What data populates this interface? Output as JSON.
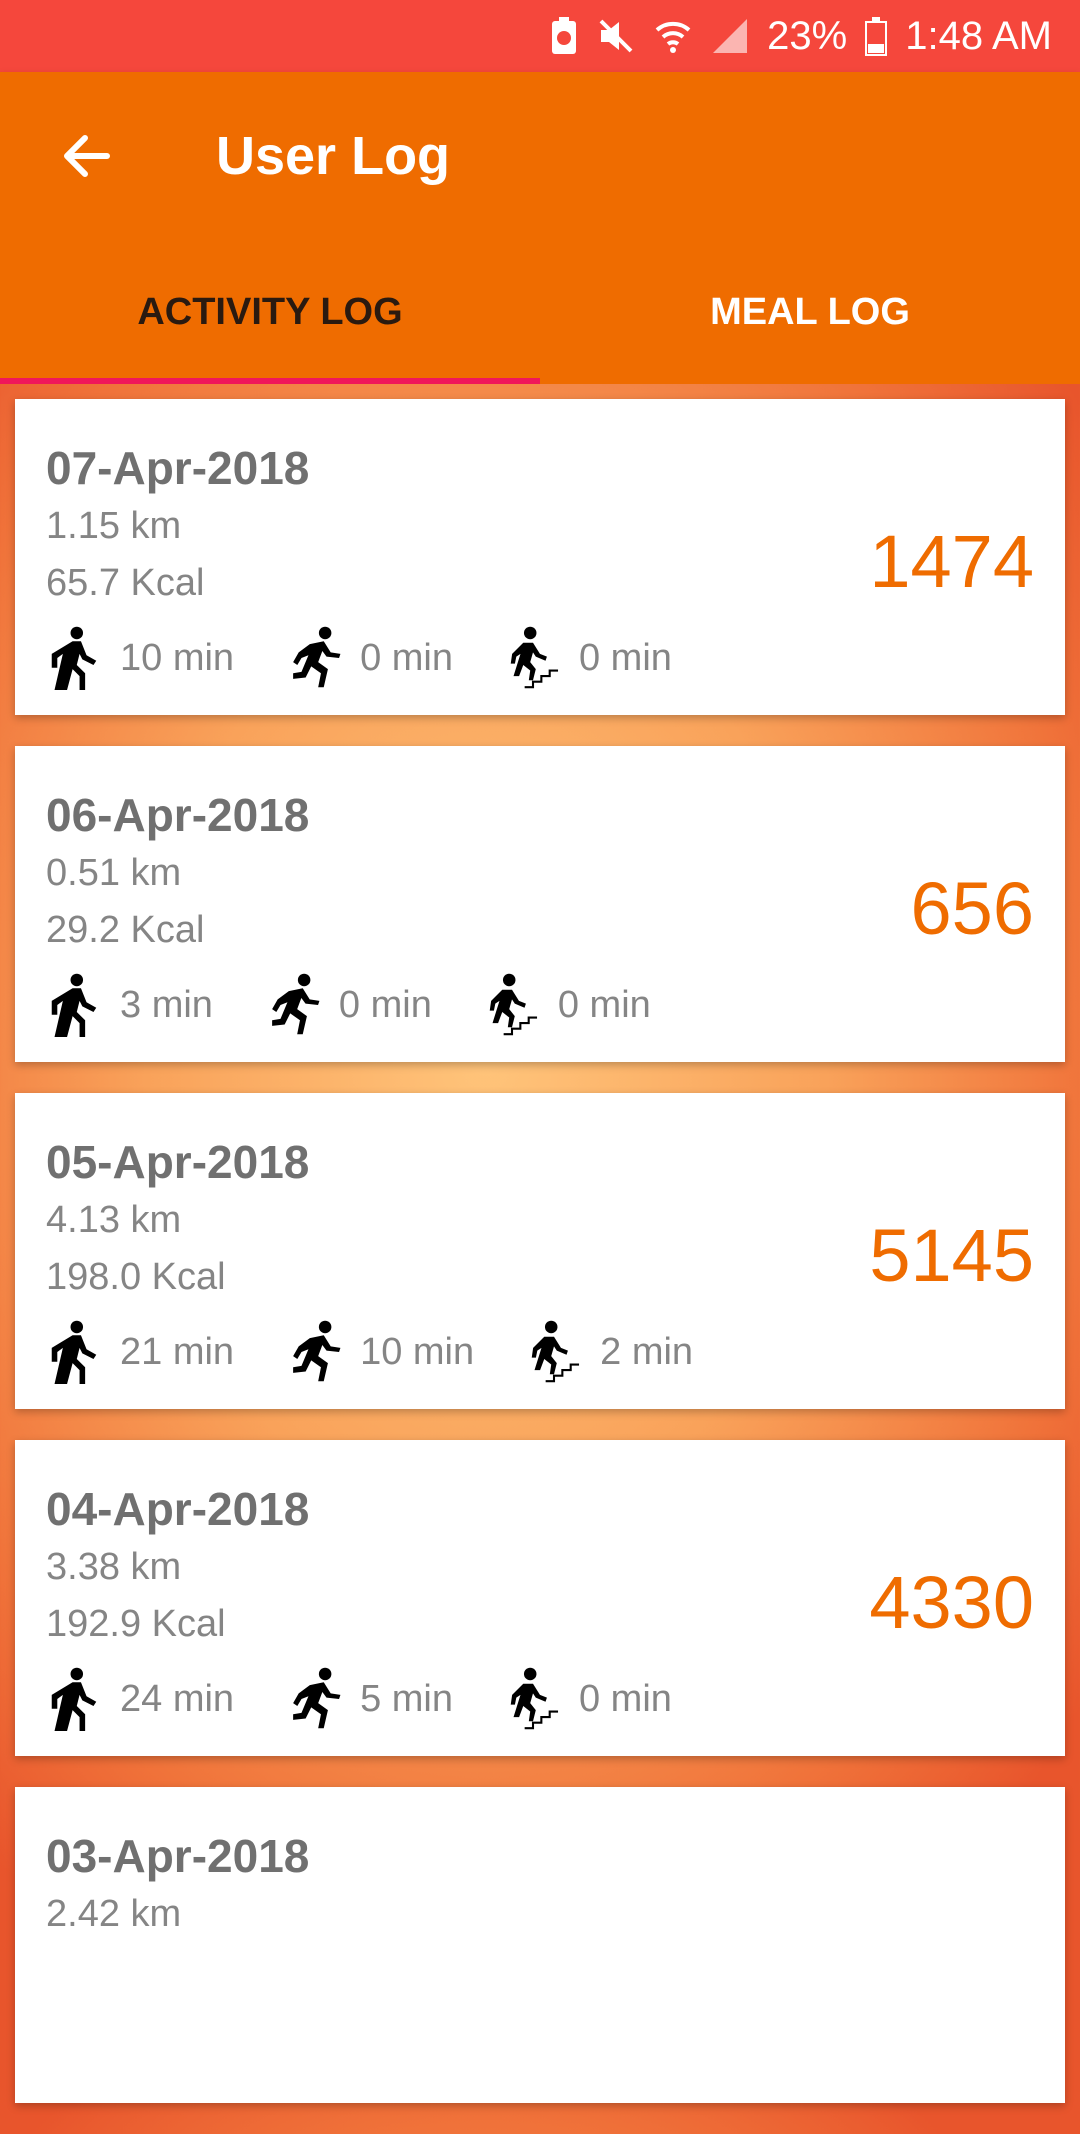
{
  "status_bar": {
    "battery": "23%",
    "time": "1:48 AM"
  },
  "app_bar": {
    "title": "User Log"
  },
  "tabs": [
    {
      "label": "ACTIVITY LOG",
      "active": true
    },
    {
      "label": "MEAL LOG",
      "active": false
    }
  ],
  "entries": [
    {
      "date": "07-Apr-2018",
      "distance": "1.15 km",
      "kcal": "65.7 Kcal",
      "steps": "1474",
      "walk": "10 min",
      "run": "0 min",
      "stairs": "0 min"
    },
    {
      "date": "06-Apr-2018",
      "distance": "0.51 km",
      "kcal": "29.2 Kcal",
      "steps": "656",
      "walk": "3 min",
      "run": "0 min",
      "stairs": "0 min"
    },
    {
      "date": "05-Apr-2018",
      "distance": "4.13 km",
      "kcal": "198.0 Kcal",
      "steps": "5145",
      "walk": "21 min",
      "run": "10 min",
      "stairs": "2 min"
    },
    {
      "date": "04-Apr-2018",
      "distance": "3.38 km",
      "kcal": "192.9 Kcal",
      "steps": "4330",
      "walk": "24 min",
      "run": "5 min",
      "stairs": "0 min"
    },
    {
      "date": "03-Apr-2018",
      "distance": "2.42 km"
    }
  ],
  "colors": {
    "status_bar": "#f5473c",
    "app_bar": "#ef6c00",
    "tab_indicator": "#f0175a",
    "steps_text": "#ef6c00"
  }
}
